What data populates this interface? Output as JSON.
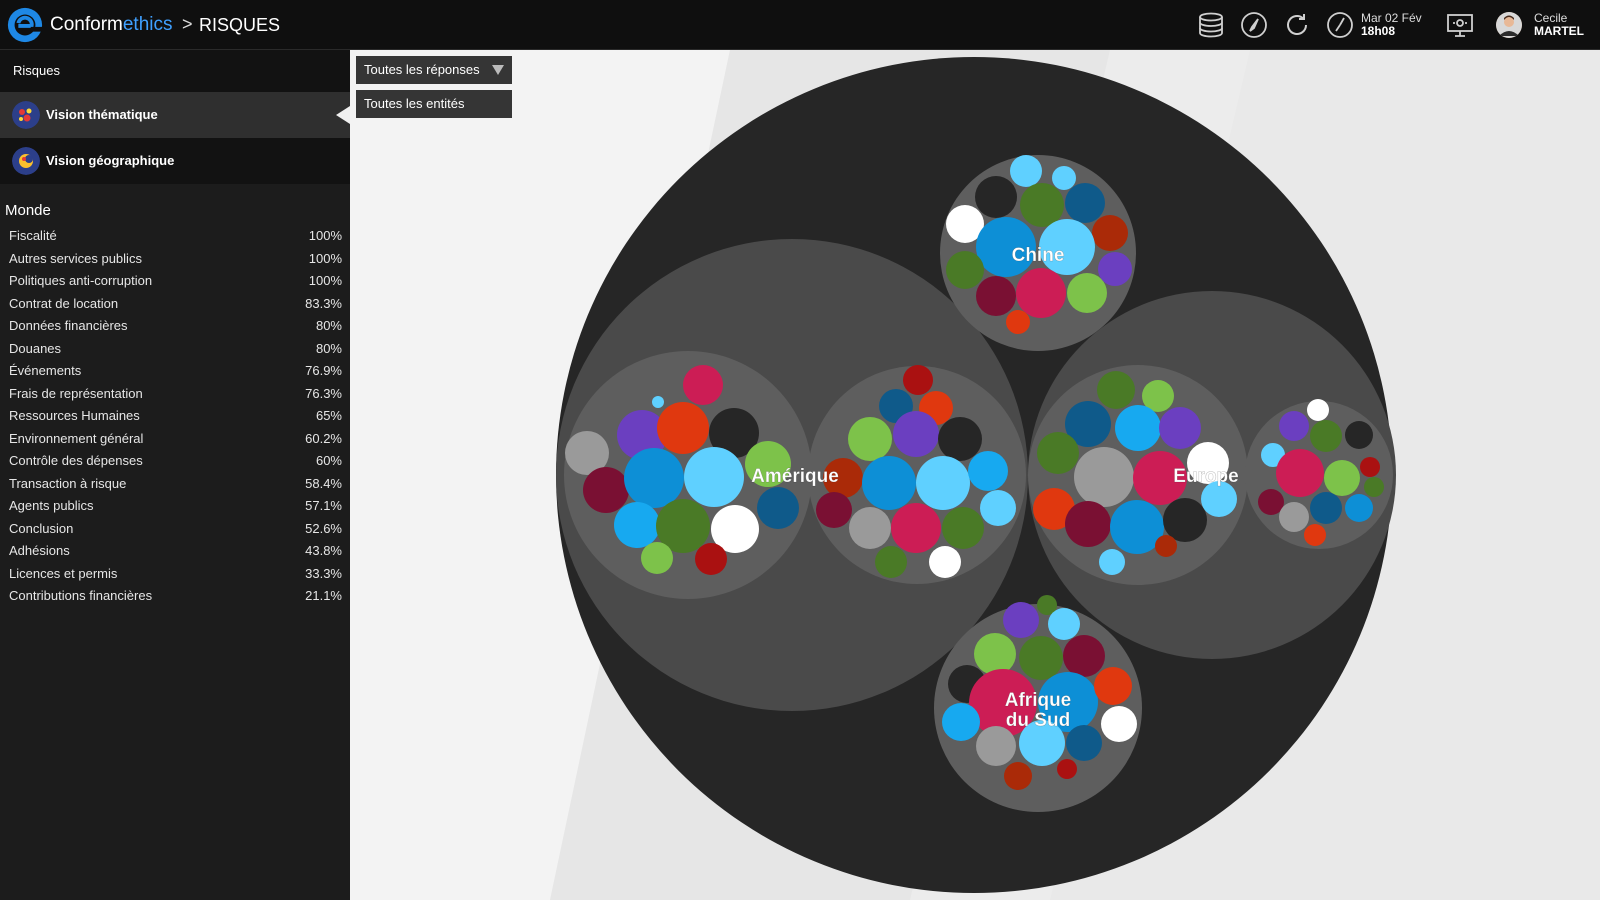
{
  "header": {
    "brand_part1": "Conform",
    "brand_part2": "ethics",
    "separator": ">",
    "section": "RISQUES",
    "date": "Mar 02 Fév",
    "time": "18h08",
    "user_first": "Cecile",
    "user_last": "MARTEL",
    "icons": [
      "database-icon",
      "compass-icon",
      "refresh-icon",
      "clock-icon",
      "screen-settings-icon",
      "avatar"
    ]
  },
  "sidebar": {
    "title": "Risques",
    "nav": [
      {
        "label": "Vision thématique",
        "active": true,
        "icon": "thematic-icon"
      },
      {
        "label": "Vision géographique",
        "active": false,
        "icon": "geography-icon"
      }
    ],
    "group_title": "Monde",
    "risks": [
      {
        "label": "Fiscalité",
        "value": "100%"
      },
      {
        "label": "Autres services publics",
        "value": "100%"
      },
      {
        "label": "Politiques anti-corruption",
        "value": "100%"
      },
      {
        "label": "Contrat de location",
        "value": "83.3%"
      },
      {
        "label": "Données financières",
        "value": "80%"
      },
      {
        "label": "Douanes",
        "value": "80%"
      },
      {
        "label": "Événements",
        "value": "76.9%"
      },
      {
        "label": "Frais de représentation",
        "value": "76.3%"
      },
      {
        "label": "Ressources Humaines",
        "value": "65%"
      },
      {
        "label": "Environnement général",
        "value": "60.2%"
      },
      {
        "label": "Contrôle des dépenses",
        "value": "60%"
      },
      {
        "label": "Transaction à risque",
        "value": "58.4%"
      },
      {
        "label": "Agents publics",
        "value": "57.1%"
      },
      {
        "label": "Conclusion",
        "value": "52.6%"
      },
      {
        "label": "Adhésions",
        "value": "43.8%"
      },
      {
        "label": "Licences et permis",
        "value": "33.3%"
      },
      {
        "label": "Contributions financières",
        "value": "21.1%"
      }
    ]
  },
  "filters": {
    "responses": "Toutes les réponses",
    "entities": "Toutes les entités"
  },
  "chart_labels": {
    "amerique": "Amérique",
    "europe": "Europe",
    "chine": "Chine",
    "afrique_line1": "Afrique",
    "afrique_line2": "du Sud"
  },
  "colors": {
    "accent": "#3fa0ff",
    "palette": [
      "#6b3fc0",
      "#e0380f",
      "#262626",
      "#cc1d55",
      "#0d8fd6",
      "#5fd0ff",
      "#7dc24a",
      "#4a7a26",
      "#0f5a8a",
      "#a11",
      "#9a9a9a",
      "#ffffff",
      "#7a1033",
      "#17a9f0",
      "#aa2a08"
    ]
  }
}
